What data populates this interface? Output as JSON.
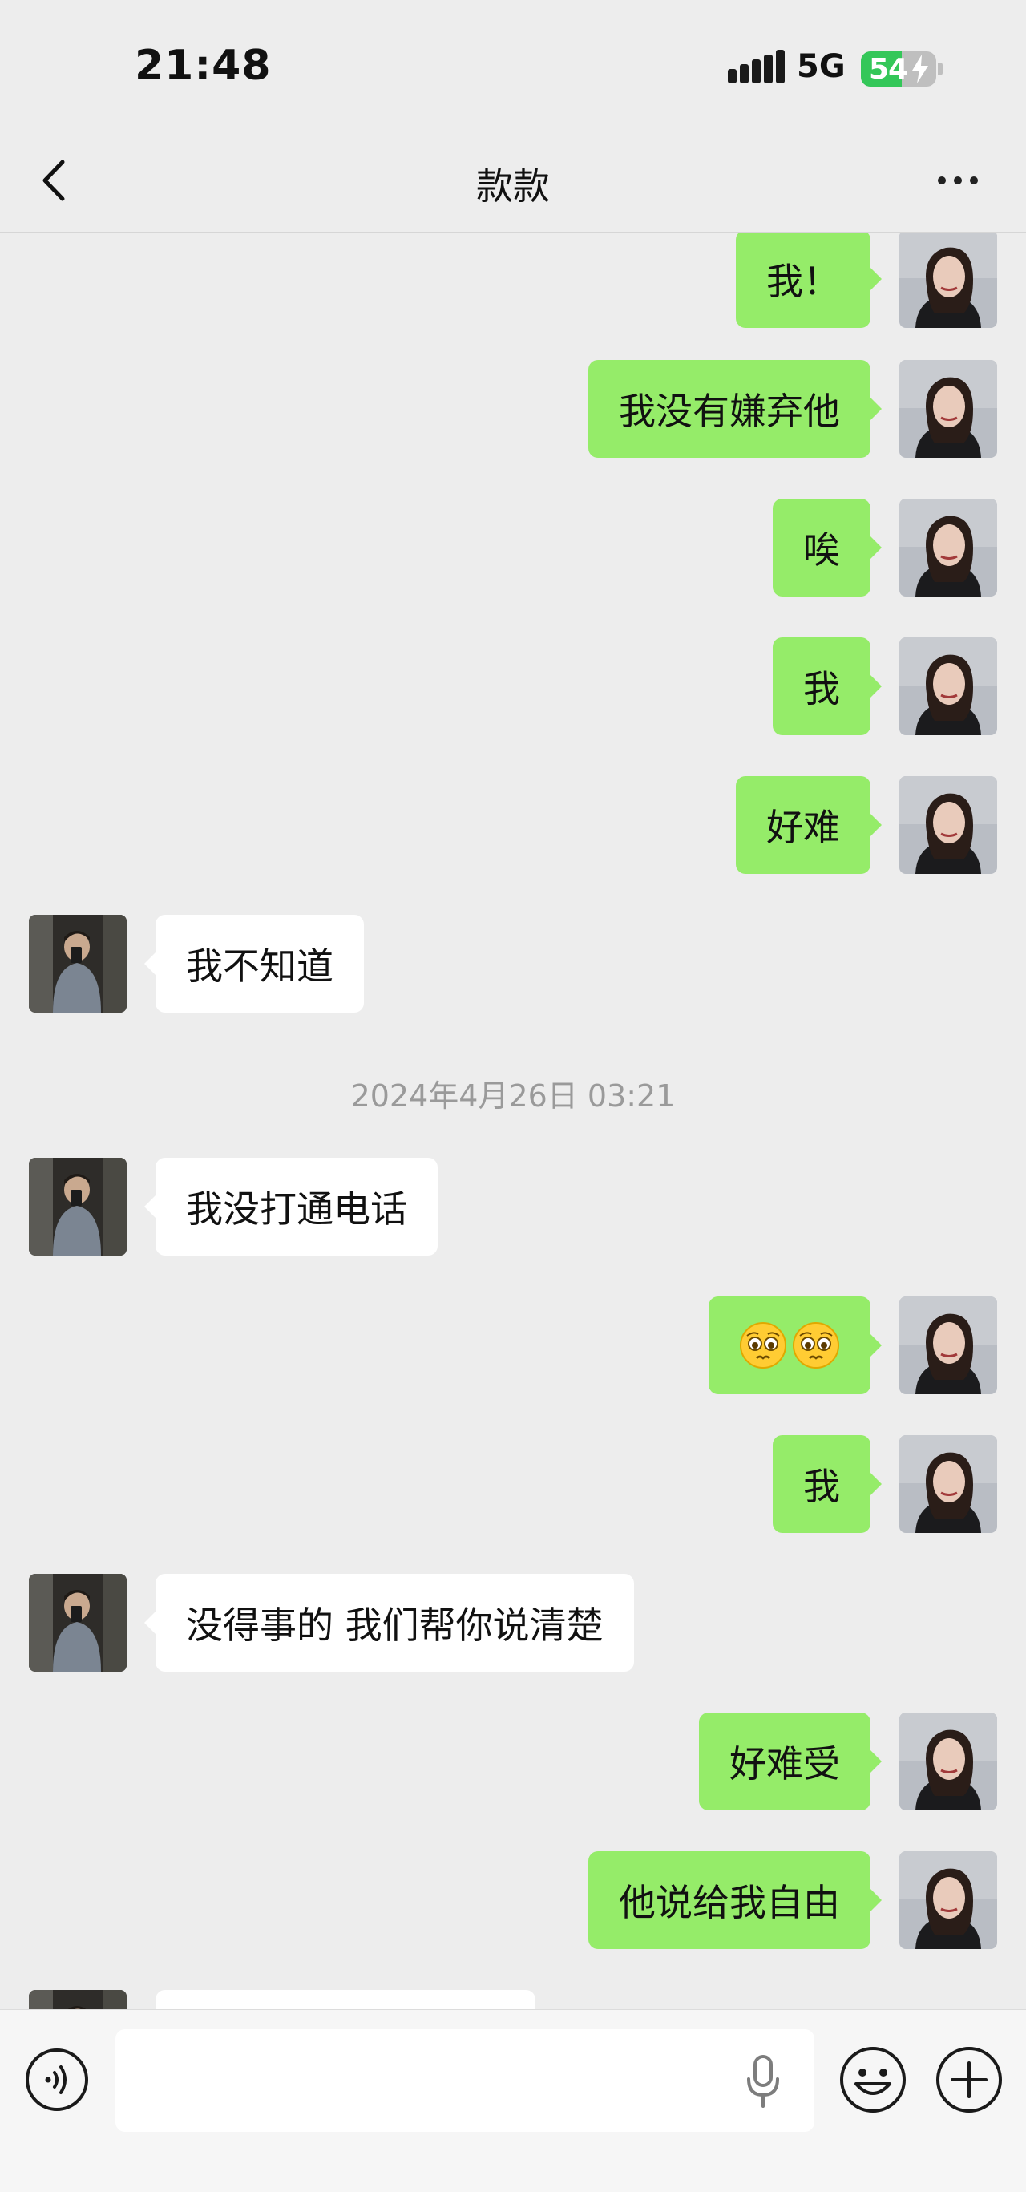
{
  "status_bar": {
    "time": "21:48",
    "network": "5G",
    "battery_text": "54",
    "battery_level": 0.54,
    "battery_color": "#34c759"
  },
  "nav": {
    "title": "款款",
    "back_icon": "chevron-left-icon",
    "more_icon": "more-dots-icon"
  },
  "colors": {
    "outgoing_bubble": "#95ec69",
    "incoming_bubble": "#ffffff",
    "background": "#ededed"
  },
  "messages": [
    {
      "sender": "me",
      "text": "我！"
    },
    {
      "sender": "me",
      "text": "我没有嫌弃他"
    },
    {
      "sender": "me",
      "text": "唉"
    },
    {
      "sender": "me",
      "text": "我"
    },
    {
      "sender": "me",
      "text": "好难"
    },
    {
      "sender": "them",
      "text": "我不知道"
    },
    {
      "timestamp": "2024年4月26日 03:21"
    },
    {
      "sender": "them",
      "text": "我没打通电话"
    },
    {
      "sender": "me",
      "emoji": [
        "🥺",
        "🥺"
      ]
    },
    {
      "sender": "me",
      "text": "我"
    },
    {
      "sender": "them",
      "text": "没得事的 我们帮你说清楚"
    },
    {
      "sender": "me",
      "text": "好难受"
    },
    {
      "sender": "me",
      "text": "他说给我自由"
    }
  ],
  "input_bar": {
    "text_value": "",
    "voice_icon": "voice-icon",
    "mic_icon": "microphone-icon",
    "emoji_icon": "emoji-icon",
    "plus_icon": "plus-icon"
  }
}
